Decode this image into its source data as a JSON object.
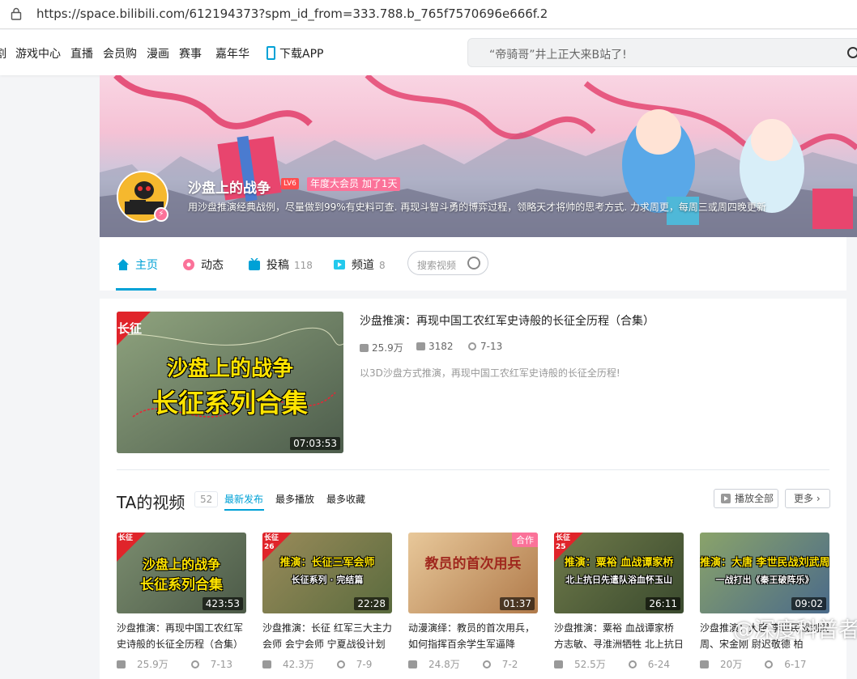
{
  "browser": {
    "url": "https://space.bilibili.com/612194373?spm_id_from=333.788.b_765f7570696e666f.2"
  },
  "topnav": {
    "items": [
      "割",
      "游戏中心",
      "直播",
      "会员购",
      "漫画",
      "赛事",
      "嘉年华",
      "下载APP"
    ],
    "search_placeholder": "“帝骑哥”井上正大来B站了!"
  },
  "profile": {
    "username": "沙盘上的战争",
    "level": "LV6",
    "vip": "年度大会员 加了1天",
    "sign": "用沙盘推演经典战例，尽量做到99%有史料可查. 再现斗智斗勇的博弈过程，领略天才将帅的思考方式. 力求周更，每周三或周四晚更新"
  },
  "tabs": [
    {
      "label": "主页",
      "count": ""
    },
    {
      "label": "动态",
      "count": ""
    },
    {
      "label": "投稿",
      "count": "118"
    },
    {
      "label": "频道",
      "count": "8"
    }
  ],
  "space_search_placeholder": "搜索视频",
  "featured": {
    "thumb_corner": "长征",
    "thumb_line1": "沙盘上的战争",
    "thumb_line2": "长征系列合集",
    "duration": "07:03:53",
    "title": "沙盘推演：再现中国工农红军史诗般的长征全历程（合集）",
    "views": "25.9万",
    "danmaku": "3182",
    "date": "7-13",
    "desc": "以3D沙盘方式推演，再现中国工农红军史诗般的长征全历程!"
  },
  "videos_section": {
    "title": "TA的视频",
    "count": "52",
    "tabs": [
      "最新发布",
      "最多播放",
      "最多收藏"
    ],
    "play_all": "播放全部",
    "more": "更多"
  },
  "videos": [
    {
      "corner": "长征",
      "line1": "沙盘上的战争",
      "line2": "长征系列合集",
      "duration": "423:53",
      "title": "沙盘推演：再现中国工农红军史诗般的长征全历程（合集）",
      "views": "25.9万",
      "date": "7-13",
      "bg1": "#7a8c6e",
      "bg2": "#4c5a48"
    },
    {
      "corner": "长征 26",
      "line1": "推演：长征三军会师",
      "line2": "长征系列 · 完结篇",
      "duration": "22:28",
      "title": "沙盘推演：长征 红军三大主力会师 会宁会师 宁夏战役计划",
      "views": "42.3万",
      "date": "7-9",
      "bg1": "#9a8b5a",
      "bg2": "#5a6b3e"
    },
    {
      "corner": "合作",
      "line1": "教员的首次用兵",
      "line2": "",
      "duration": "01:37",
      "title": "动漫演绎：教员的首次用兵，如何指挥百余学生军逼降",
      "views": "24.8万",
      "date": "7-2",
      "bg1": "#e8c89a",
      "bg2": "#b07a4a"
    },
    {
      "corner": "长征 25",
      "line1": "推演：粟裕 血战谭家桥",
      "line2": "北上抗日先遣队浴血怀玉山",
      "duration": "26:11",
      "title": "沙盘推演：粟裕 血战谭家桥 方志敏、寻淮洲牺牲 北上抗日",
      "views": "52.5万",
      "date": "6-24",
      "bg1": "#6f7a4a",
      "bg2": "#3a4a2e"
    },
    {
      "corner": "",
      "line1": "推演：大唐 李世民战刘武周",
      "line2": "一战打出《秦王破阵乐》",
      "duration": "09:02",
      "title": "沙盘推演：大唐 李世民战刘武周、宋金刚 尉迟敬德 柏",
      "views": "20万",
      "date": "6-17",
      "bg1": "#8aa36a",
      "bg2": "#4a6a8a"
    }
  ],
  "watermark": "@深度科普者",
  "colors": {
    "accent": "#00a1d6",
    "pink": "#fb7299"
  }
}
